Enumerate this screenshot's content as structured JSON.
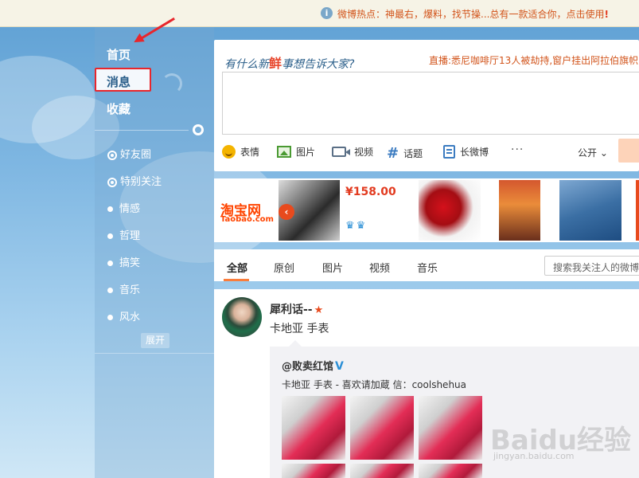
{
  "notice_bar": {
    "info_glyph": "i",
    "text": "微博热点：神最右，爆料，找节操...总有一款适合你，点击使用",
    "mark": "!"
  },
  "nav": {
    "home": "首页",
    "messages": "消息",
    "favorites": "收藏",
    "sub_items": [
      {
        "label": "好友圈",
        "icon": "ring"
      },
      {
        "label": "特别关注",
        "icon": "ring"
      },
      {
        "label": "情感",
        "icon": "dot"
      },
      {
        "label": "哲理",
        "icon": "dot"
      },
      {
        "label": "搞笑",
        "icon": "dot"
      },
      {
        "label": "音乐",
        "icon": "dot"
      },
      {
        "label": "风水",
        "icon": "dot"
      }
    ],
    "expand": "展开"
  },
  "publisher": {
    "prompt_before": "有什么新",
    "prompt_fresh": "鲜",
    "prompt_after": "事想告诉大家?",
    "hot_news": "直播:悉尼咖啡厅13人被劫持,窗户挂出阿拉伯旗帜",
    "tools": [
      "表情",
      "图片",
      "视频",
      "话题",
      "长微博"
    ],
    "more": "···",
    "privacy": "公开 ⌄"
  },
  "ad": {
    "brand": "淘宝网",
    "brand_url": "Taobao.com",
    "prev_glyph": "‹",
    "price": "¥158.00"
  },
  "tabs": {
    "items": [
      "全部",
      "原创",
      "图片",
      "视频",
      "音乐"
    ],
    "search_placeholder": "搜索我关注人的微博"
  },
  "feed": {
    "author": "犀利话--",
    "author_badge": "★",
    "text": "卡地亚 手表",
    "repost": {
      "author": "@败卖红馆",
      "verified": "V",
      "text": "卡地亚 手表 - 喜欢请加蔵 信：coolshehua"
    }
  },
  "watermark": {
    "logo": "Baidu经验",
    "url": "jingyan.baidu.com"
  },
  "colors": {
    "accent_orange": "#fa7d3c",
    "highlight_red": "#e8262c",
    "notice_text": "#d2541b",
    "sky_top": "#5d9fd3"
  }
}
